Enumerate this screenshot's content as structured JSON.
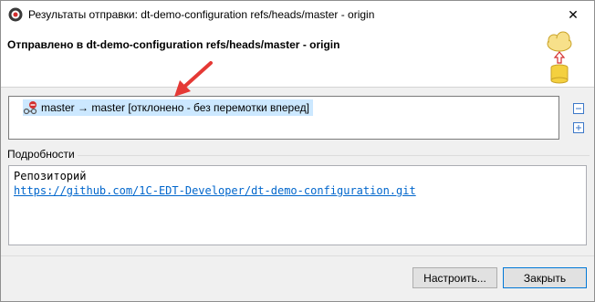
{
  "window": {
    "title": "Результаты отправки: dt-demo-configuration refs/heads/master - origin",
    "close_glyph": "✕"
  },
  "banner": {
    "title": "Отправлено в dt-demo-configuration refs/heads/master - origin",
    "icon": "push-to-cloud-icon"
  },
  "results": {
    "items": [
      {
        "icon": "branch-rejected-icon",
        "text": "master → master [отклонено - без перемотки вперед]"
      }
    ],
    "collapse_icon": "collapse-all-icon",
    "expand_icon": "expand-all-icon"
  },
  "details": {
    "group_label": "Подробности",
    "repo_label": "Репозиторий",
    "repo_url": "https://github.com/1C-EDT-Developer/dt-demo-configuration.git"
  },
  "buttons": {
    "configure": "Настроить...",
    "close": "Закрыть"
  },
  "colors": {
    "annotation_arrow": "#e53935",
    "selection": "#cce8ff",
    "link": "#0066cc"
  }
}
